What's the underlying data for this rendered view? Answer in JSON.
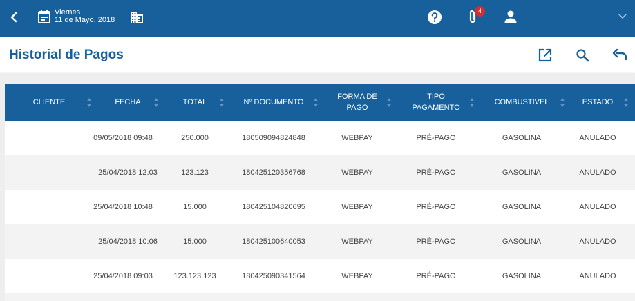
{
  "topbar": {
    "date_day": "Viernes",
    "date_full": "11 de Mayo, 2018",
    "attachments_badge": "4",
    "icons": [
      "back-arrow-icon",
      "calendar-icon",
      "building-icon",
      "help-icon",
      "paperclip-icon",
      "user-icon",
      "chevron-down-icon"
    ]
  },
  "page": {
    "title": "Historial de Pagos",
    "actions": [
      "open-in-new-icon",
      "search-icon",
      "undo-icon"
    ]
  },
  "colors": {
    "primary": "#17609c",
    "badge": "#d32f2f",
    "row_alt": "#f3f3f3"
  },
  "table": {
    "headers": [
      "CLIENTE",
      "FECHA",
      "TOTAL",
      "Nº DOCUMENTO",
      "FORMA DE PAGO",
      "TIPO PAGAMENTO",
      "COMBUSTIVEL",
      "ESTADO"
    ],
    "rows": [
      {
        "cliente": "",
        "fecha": "09/05/2018 09:48",
        "total": "250.000",
        "documento": "180509094824848",
        "forma": "WEBPAY",
        "tipo": "PRÉ-PAGO",
        "combustivel": "GASOLINA",
        "estado": "ANULADO"
      },
      {
        "cliente": "",
        "fecha": "25/04/2018 12:03",
        "total": "123.123",
        "documento": "180425120356768",
        "forma": "WEBPAY",
        "tipo": "PRÉ-PAGO",
        "combustivel": "GASOLINA",
        "estado": "ANULADO"
      },
      {
        "cliente": "",
        "fecha": "25/04/2018 10:48",
        "total": "15.000",
        "documento": "180425104820695",
        "forma": "WEBPAY",
        "tipo": "PRÉ-PAGO",
        "combustivel": "GASOLINA",
        "estado": "ANULADO"
      },
      {
        "cliente": "",
        "fecha": "25/04/2018 10:06",
        "total": "15.000",
        "documento": "180425100640053",
        "forma": "WEBPAY",
        "tipo": "PRÉ-PAGO",
        "combustivel": "GASOLINA",
        "estado": "ANULADO"
      },
      {
        "cliente": "",
        "fecha": "25/04/2018 09:03",
        "total": "123.123.123",
        "documento": "180425090341564",
        "forma": "WEBPAY",
        "tipo": "PRÉ-PAGO",
        "combustivel": "GASOLINA",
        "estado": "ANULADO"
      }
    ]
  }
}
